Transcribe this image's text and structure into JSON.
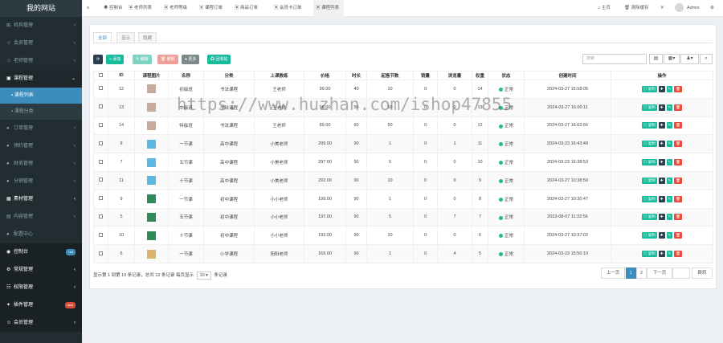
{
  "sidebar": {
    "logo": "我的网站",
    "items": [
      {
        "label": "机构管理",
        "icon": "⊞",
        "arrow": "‹"
      },
      {
        "label": "会员管理",
        "icon": "☺",
        "arrow": "‹"
      },
      {
        "label": "老师管理",
        "icon": "☺",
        "arrow": "‹"
      },
      {
        "label": "课程管理",
        "icon": "▣",
        "arrow": "⌄",
        "open": true
      },
      {
        "label": "课程列表",
        "sub": true,
        "active": true
      },
      {
        "label": "课程分类",
        "sub": true
      },
      {
        "label": "订单管理",
        "icon": "●",
        "arrow": "‹"
      },
      {
        "label": "预约管理",
        "icon": "●",
        "arrow": "‹"
      },
      {
        "label": "财务管理",
        "icon": "●",
        "arrow": "‹"
      },
      {
        "label": "分销管理",
        "icon": "●",
        "arrow": "‹"
      },
      {
        "label": "素材管理",
        "icon": "▦",
        "arrow": "‹",
        "bold": true
      },
      {
        "label": "内容管理",
        "icon": "▤",
        "arrow": "‹"
      },
      {
        "label": "配置中心",
        "icon": "●"
      },
      {
        "label": "控制台",
        "icon": "◉",
        "dark": true,
        "badge": "hot",
        "badge_color": "#3c8dbc"
      },
      {
        "label": "常规管理",
        "icon": "⚙",
        "arrow": "‹",
        "dark": true
      },
      {
        "label": "权限管理",
        "icon": "☷",
        "arrow": "‹",
        "dark": true
      },
      {
        "label": "插件管理",
        "icon": "✦",
        "dark": true,
        "badge": "new",
        "badge_color": "#dd4b39"
      },
      {
        "label": "会员管理",
        "icon": "☺",
        "arrow": "‹",
        "dark": true
      }
    ]
  },
  "topbar": {
    "menu_icon": "≡",
    "tabs": [
      {
        "label": "控制台",
        "icon": "◉"
      },
      {
        "label": "老师列表",
        "icon": "▣"
      },
      {
        "label": "老师等级",
        "icon": "▣"
      },
      {
        "label": "课程订单",
        "icon": "▣"
      },
      {
        "label": "商品订单",
        "icon": "▣"
      },
      {
        "label": "会员卡订单",
        "icon": "▣"
      },
      {
        "label": "课程列表",
        "icon": "▣",
        "active": true
      }
    ],
    "home": "主页",
    "clear_cache": "清除缓存",
    "fullscreen": "✕",
    "user": "Admin"
  },
  "subtabs": [
    "全部",
    "显示",
    "隐藏"
  ],
  "toolbar": {
    "buttons": [
      {
        "label": "⟳",
        "color": "#2c3e50"
      },
      {
        "label": "+ 添加",
        "color": "#18bc9c"
      },
      {
        "label": "✎ 编辑",
        "color": "#7fd3c3"
      },
      {
        "label": "🗑 删除",
        "color": "#f0a09a"
      },
      {
        "label": "● 更多",
        "color": "#7b8a8b"
      },
      {
        "label": "♻ 回收站",
        "color": "#18bc9c"
      }
    ],
    "search_placeholder": "搜索",
    "icons": [
      "▤",
      "▦▾",
      "♟▾",
      "⌕"
    ]
  },
  "table": {
    "headers": [
      "",
      "ID",
      "课程图片",
      "名称",
      "分类",
      "上课教练",
      "价格",
      "时长",
      "起售节数",
      "销量",
      "浏览量",
      "权重",
      "状态",
      "创建时间",
      "操作"
    ],
    "rows": [
      {
        "id": "12",
        "img": "#c8a99a",
        "name": "初级班",
        "cat": "书法课程",
        "coach": "王老师",
        "price": "99.00",
        "dur": "40",
        "start": "10",
        "sales": "0",
        "views": "0",
        "weight": "14",
        "status": "正常",
        "time": "2024-03-27 15:58:05"
      },
      {
        "id": "13",
        "img": "#c8a99a",
        "name": "中级班",
        "cat": "书法课程",
        "coach": "王老师",
        "price": "98.00",
        "dur": "50",
        "start": "10",
        "sales": "0",
        "views": "0",
        "weight": "13",
        "status": "正常",
        "time": "2024-03-27 16:00:11"
      },
      {
        "id": "14",
        "img": "#c8a99a",
        "name": "特级班",
        "cat": "书法课程",
        "coach": "王老师",
        "price": "89.00",
        "dur": "60",
        "start": "50",
        "sales": "0",
        "views": "0",
        "weight": "12",
        "status": "正常",
        "time": "2024-03-27 16:02:56"
      },
      {
        "id": "8",
        "img": "#5bb8e0",
        "name": "一节课",
        "cat": "高中课程",
        "coach": "小美老师",
        "price": "299.00",
        "dur": "90",
        "start": "1",
        "sales": "0",
        "views": "1",
        "weight": "11",
        "status": "正常",
        "time": "2024-03-23 16:43:49"
      },
      {
        "id": "7",
        "img": "#5bb8e0",
        "name": "五节课",
        "cat": "高中课程",
        "coach": "小美老师",
        "price": "297.00",
        "dur": "90",
        "start": "5",
        "sales": "0",
        "views": "0",
        "weight": "10",
        "status": "正常",
        "time": "2024-03-23 16:38:53"
      },
      {
        "id": "11",
        "img": "#5bb8e0",
        "name": "十节课",
        "cat": "高中课程",
        "coach": "小美老师",
        "price": "292.00",
        "dur": "90",
        "start": "10",
        "sales": "0",
        "views": "0",
        "weight": "9",
        "status": "正常",
        "time": "2024-03-27 10:38:50"
      },
      {
        "id": "9",
        "img": "#2e8b57",
        "name": "一节课",
        "cat": "初中课程",
        "coach": "小小老师",
        "price": "199.00",
        "dur": "90",
        "start": "1",
        "sales": "0",
        "views": "0",
        "weight": "8",
        "status": "正常",
        "time": "2024-03-27 10:30:47"
      },
      {
        "id": "5",
        "img": "#2e8b57",
        "name": "五节课",
        "cat": "初中课程",
        "coach": "小小老师",
        "price": "197.00",
        "dur": "90",
        "start": "5",
        "sales": "0",
        "views": "7",
        "weight": "7",
        "status": "正常",
        "time": "2023-08-07 11:32:56"
      },
      {
        "id": "10",
        "img": "#2e8b57",
        "name": "十节课",
        "cat": "初中课程",
        "coach": "小小老师",
        "price": "192.00",
        "dur": "90",
        "start": "10",
        "sales": "0",
        "views": "0",
        "weight": "6",
        "status": "正常",
        "time": "2024-03-27 10:37:02"
      },
      {
        "id": "6",
        "img": "#d9b46a",
        "name": "一节课",
        "cat": "小学课程",
        "coach": "阳阳老师",
        "price": "169.00",
        "dur": "90",
        "start": "1",
        "sales": "0",
        "views": "4",
        "weight": "5",
        "status": "正常",
        "time": "2024-03-23 15:50:10"
      }
    ],
    "ops": [
      {
        "label": "◎ 复制",
        "color": "#18bc9c"
      },
      {
        "label": "✚",
        "color": "#2c3e50"
      },
      {
        "label": "✎",
        "color": "#18bc9c"
      },
      {
        "label": "🗑",
        "color": "#e74c3c"
      }
    ]
  },
  "footer": {
    "summary": "显示第 1 到第 10 条记录，总共 12 条记录 每页显示",
    "page_size": "10 ▾",
    "suffix": "条记录"
  },
  "pagination": {
    "prev": "上一页",
    "pages": [
      "1",
      "2"
    ],
    "next": "下一页",
    "goto": "跳转"
  },
  "watermark": "https://www.huzhan.com/ishop47855"
}
